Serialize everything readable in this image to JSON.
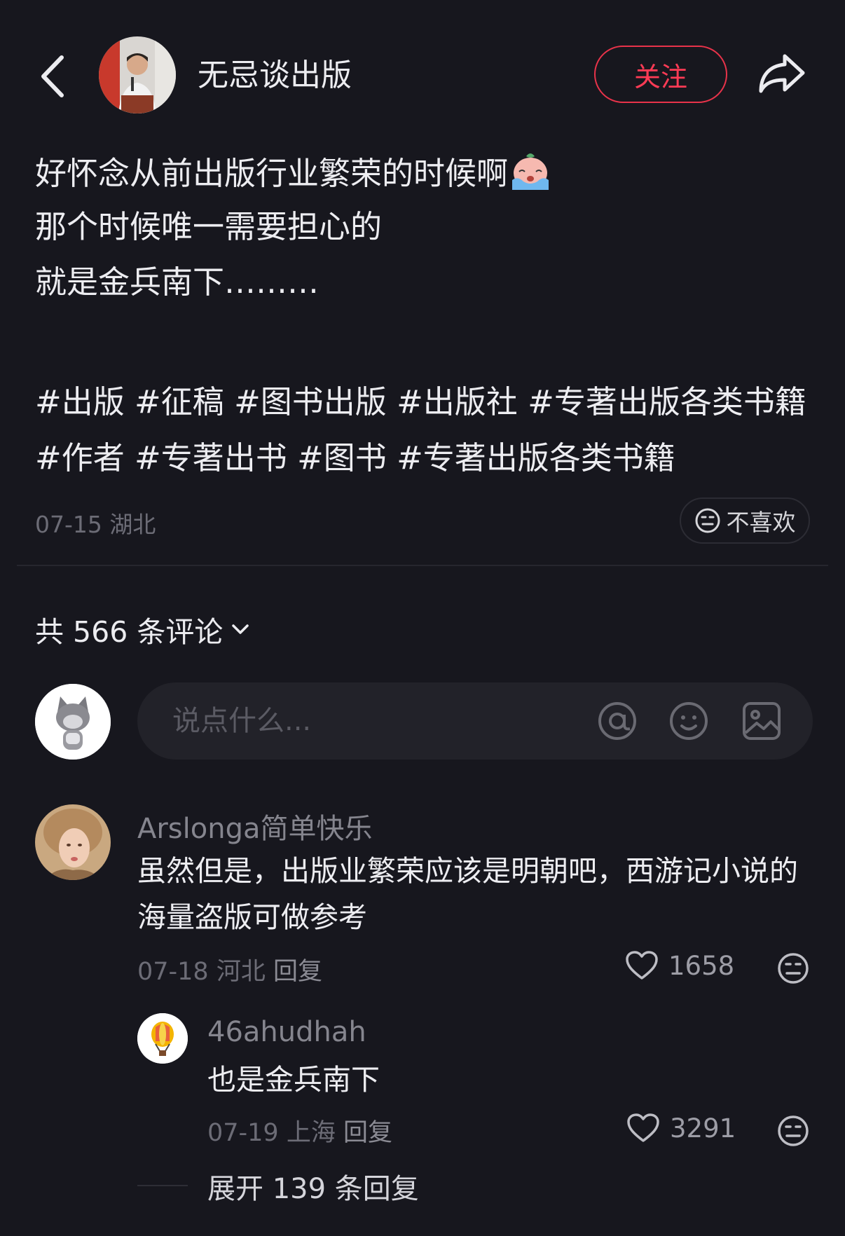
{
  "header": {
    "author_name": "无忌谈出版",
    "follow_label": "关注"
  },
  "post": {
    "lines": [
      "好怀念从前出版行业繁荣的时候啊",
      "那个时候唯一需要担心的",
      "就是金兵南下………"
    ],
    "emoji": "crying-face-emoji",
    "tags": [
      "#出版",
      "#征稿",
      "#图书出版",
      "#出版社",
      "#专著出版各类书籍",
      "#作者",
      "#专著出书",
      "#图书",
      "#专著出版各类书籍"
    ],
    "date": "07-15",
    "location": "湖北",
    "dislike_label": "不喜欢"
  },
  "comments_header": {
    "label": "共 566 条评论"
  },
  "composer": {
    "placeholder": "说点什么..."
  },
  "comments": [
    {
      "user": "Arslonga简单快乐",
      "text": "虽然但是，出版业繁荣应该是明朝吧，西游记小说的海量盗版可做参考",
      "date": "07-18",
      "location": "河北",
      "reply_label": "回复",
      "likes": "1658"
    }
  ],
  "reply": {
    "user": "46ahudhah",
    "text": "也是金兵南下",
    "date": "07-19",
    "location": "上海",
    "reply_label": "回复",
    "likes": "3291"
  },
  "expand_label": "展开 139 条回复",
  "colors": {
    "background": "#17171e",
    "accent": "#ff3b55",
    "muted": "#6c6c76"
  }
}
